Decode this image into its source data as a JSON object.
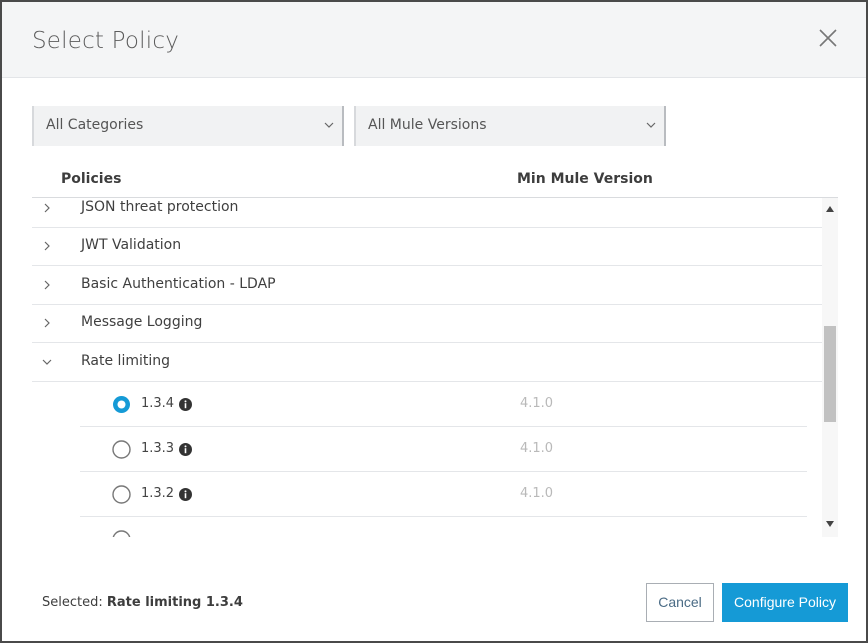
{
  "dialog": {
    "title": "Select Policy"
  },
  "filters": {
    "category": {
      "value": "All Categories"
    },
    "mule_version": {
      "value": "All Mule Versions"
    }
  },
  "table": {
    "columns": [
      "Policies",
      "Min Mule Version"
    ],
    "policies": [
      {
        "label": "JSON threat protection",
        "expanded": false
      },
      {
        "label": "JWT Validation",
        "expanded": false
      },
      {
        "label": "Basic Authentication - LDAP",
        "expanded": false
      },
      {
        "label": "Message Logging",
        "expanded": false
      },
      {
        "label": "Rate limiting",
        "expanded": true
      }
    ],
    "versions": [
      {
        "version": "1.3.4",
        "min_mule_version": "4.1.0",
        "selected": true
      },
      {
        "version": "1.3.3",
        "min_mule_version": "4.1.0",
        "selected": false
      },
      {
        "version": "1.3.2",
        "min_mule_version": "4.1.0",
        "selected": false
      },
      {
        "version": "",
        "min_mule_version": "",
        "selected": false
      }
    ]
  },
  "footer": {
    "selected_prefix": "Selected:",
    "selected_value": "Rate limiting 1.3.4",
    "cancel_label": "Cancel",
    "configure_label": "Configure Policy"
  },
  "colors": {
    "primary": "#159ad6",
    "radio_selected": "#159ad6",
    "muted_text": "#b9b9b9"
  },
  "icons": {
    "close": "close-icon",
    "dropdown": "chevron-down-icon",
    "collapsed": "chevron-right-icon",
    "expanded": "chevron-down-icon",
    "info": "info-icon",
    "scroll_up": "scroll-up-arrow-icon",
    "scroll_down": "scroll-down-arrow-icon"
  }
}
